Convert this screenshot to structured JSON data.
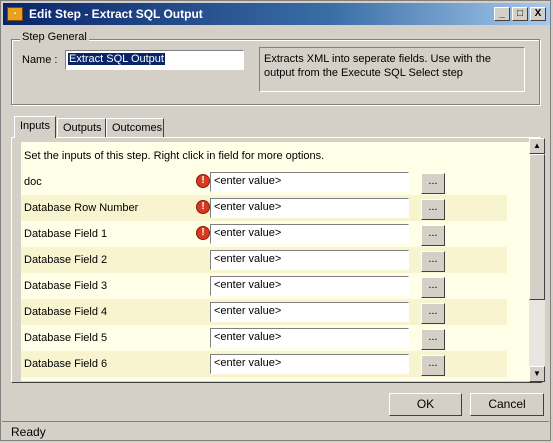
{
  "window": {
    "title": "Edit Step - Extract SQL Output"
  },
  "caption_buttons": {
    "minimize": "_",
    "maximize": "□",
    "close": "X"
  },
  "step_general": {
    "legend": "Step General",
    "name_label": "Name :",
    "name_value": "Extract SQL Output",
    "description": "Extracts XML into seperate fields. Use with the output from the Execute SQL Select step"
  },
  "tabs": [
    {
      "label": "Inputs"
    },
    {
      "label": "Outputs"
    },
    {
      "label": "Outcomes"
    }
  ],
  "inputs": {
    "hint": "Set the inputs of this step.  Right click in field for more options.",
    "rows": [
      {
        "label": "doc",
        "value": "<enter value>",
        "error": true
      },
      {
        "label": "Database Row Number",
        "value": "<enter value>",
        "error": true
      },
      {
        "label": "Database Field 1",
        "value": "<enter value>",
        "error": true
      },
      {
        "label": "Database Field 2",
        "value": "<enter value>",
        "error": false
      },
      {
        "label": "Database Field 3",
        "value": "<enter value>",
        "error": false
      },
      {
        "label": "Database Field 4",
        "value": "<enter value>",
        "error": false
      },
      {
        "label": "Database Field 5",
        "value": "<enter value>",
        "error": false
      },
      {
        "label": "Database Field 6",
        "value": "<enter value>",
        "error": false
      }
    ],
    "ellipsis_label": "..."
  },
  "buttons": {
    "ok": "OK",
    "cancel": "Cancel"
  },
  "status": {
    "text": "Ready"
  }
}
